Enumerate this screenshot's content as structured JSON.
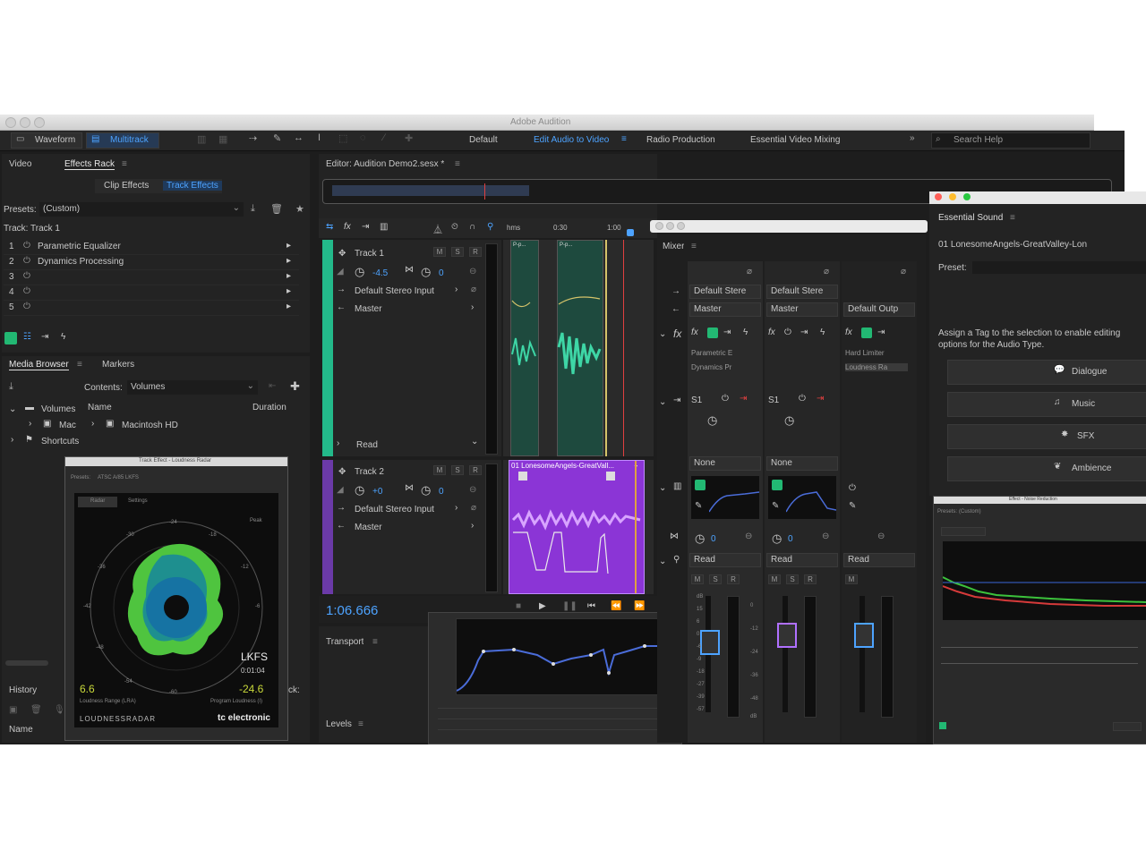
{
  "window_title": "Adobe Audition",
  "toolbar": {
    "waveform": "Waveform",
    "multitrack": "Multitrack",
    "workspaces": [
      "Default",
      "Edit Audio to Video",
      "Radio Production",
      "Essential Video Mixing"
    ],
    "search_placeholder": "Search Help"
  },
  "left_top": {
    "tabs": [
      "Video",
      "Effects Rack"
    ],
    "subtabs": [
      "Clip Effects",
      "Track Effects"
    ],
    "presets_label": "Presets:",
    "presets_value": "(Custom)",
    "track_label": "Track: Track 1",
    "effects": [
      {
        "num": "1",
        "name": "Parametric Equalizer"
      },
      {
        "num": "2",
        "name": "Dynamics Processing"
      },
      {
        "num": "3",
        "name": ""
      },
      {
        "num": "4",
        "name": ""
      },
      {
        "num": "5",
        "name": ""
      }
    ]
  },
  "media_browser": {
    "tabs": [
      "Media Browser",
      "Markers"
    ],
    "contents_label": "Contents:",
    "contents_value": "Volumes",
    "col_name": "Name",
    "col_duration": "Duration",
    "tree": [
      "Volumes",
      "Mac",
      "Shortcuts"
    ],
    "items": [
      "Macintosh HD"
    ],
    "history_label": "History",
    "name_label": "Name"
  },
  "loudness": {
    "title": "Track Effect - Loudness Radar",
    "presets": "Presets:",
    "preset_value": "ATSC A/85 LKFS",
    "tabs": [
      "Radar",
      "Settings"
    ],
    "scale": [
      "-24",
      "-18",
      "-12",
      "-6",
      "-30",
      "-36",
      "-42",
      "-48",
      "-54",
      "-60"
    ],
    "peak": "Peak",
    "unit": "LKFS",
    "time": "0:01:04",
    "lra_value": "6.6",
    "lra_label": "Loudness Range (LRA)",
    "program_value": "-24.6",
    "program_label": "Program Loudness (I)",
    "brand_left": "LOUDNESSRADAR",
    "brand_right": "tc electronic",
    "partial_label": "ck:"
  },
  "editor": {
    "title": "Editor: Audition Demo2.sesx *",
    "ruler": [
      "hms",
      "0:30",
      "1:00"
    ],
    "tracks": [
      {
        "name": "Track 1",
        "vol": "-4.5",
        "pan": "0",
        "input": "Default Stereo Input",
        "output": "Master",
        "mode": "Read"
      },
      {
        "name": "Track 2",
        "vol": "+0",
        "pan": "0",
        "input": "Default Stereo Input",
        "output": "Master"
      }
    ],
    "clip_labels": [
      "P-p...",
      "P-p..."
    ],
    "clip2_name": "01 LonesomeAngels-GreatVall...",
    "timecode": "1:06.666",
    "transport": "Transport",
    "levels": "Levels",
    "msr": [
      "M",
      "S",
      "R"
    ]
  },
  "mixer": {
    "title": "Mixer",
    "channels": [
      {
        "input": "Default Stere",
        "output": "Master",
        "fx": [
          "Parametric E",
          "Dynamics Pr"
        ],
        "send": "S1",
        "send_target": "None",
        "mode": "Read",
        "pan": "0"
      },
      {
        "input": "Default Stere",
        "output": "Master",
        "fx": [],
        "send": "S1",
        "send_target": "None",
        "mode": "Read",
        "pan": "0"
      },
      {
        "input": "",
        "output": "Default Outp",
        "fx": [
          "Hard Limiter",
          "Loudness Ra"
        ],
        "send": "",
        "send_target": "",
        "mode": "Read",
        "pan": ""
      }
    ],
    "db_scale": [
      "dB",
      "15",
      "6",
      "0",
      "-6",
      "-9",
      "-18",
      "-27",
      "-39",
      "-57"
    ],
    "meter_scale": [
      "0",
      "-12",
      "-24",
      "-36",
      "-48",
      "dB"
    ]
  },
  "essential_sound": {
    "title": "Essential Sound",
    "file": "01 LonesomeAngels-GreatValley-Lon",
    "preset_label": "Preset:",
    "instruction": "Assign a Tag to the selection to enable editing options for the Audio Type.",
    "buttons": [
      "Dialogue",
      "Music",
      "SFX",
      "Ambience"
    ]
  },
  "noise_reduction": {
    "title": "Effect - Noise Reduction",
    "presets": "Presets:",
    "preset_value": "(Custom)"
  },
  "colors": {
    "accent": "#4da3ff",
    "track1": "#23b98a",
    "track2": "#6b3aa8",
    "clip_purple": "#8b35d6",
    "meter_green": "#22b873"
  }
}
